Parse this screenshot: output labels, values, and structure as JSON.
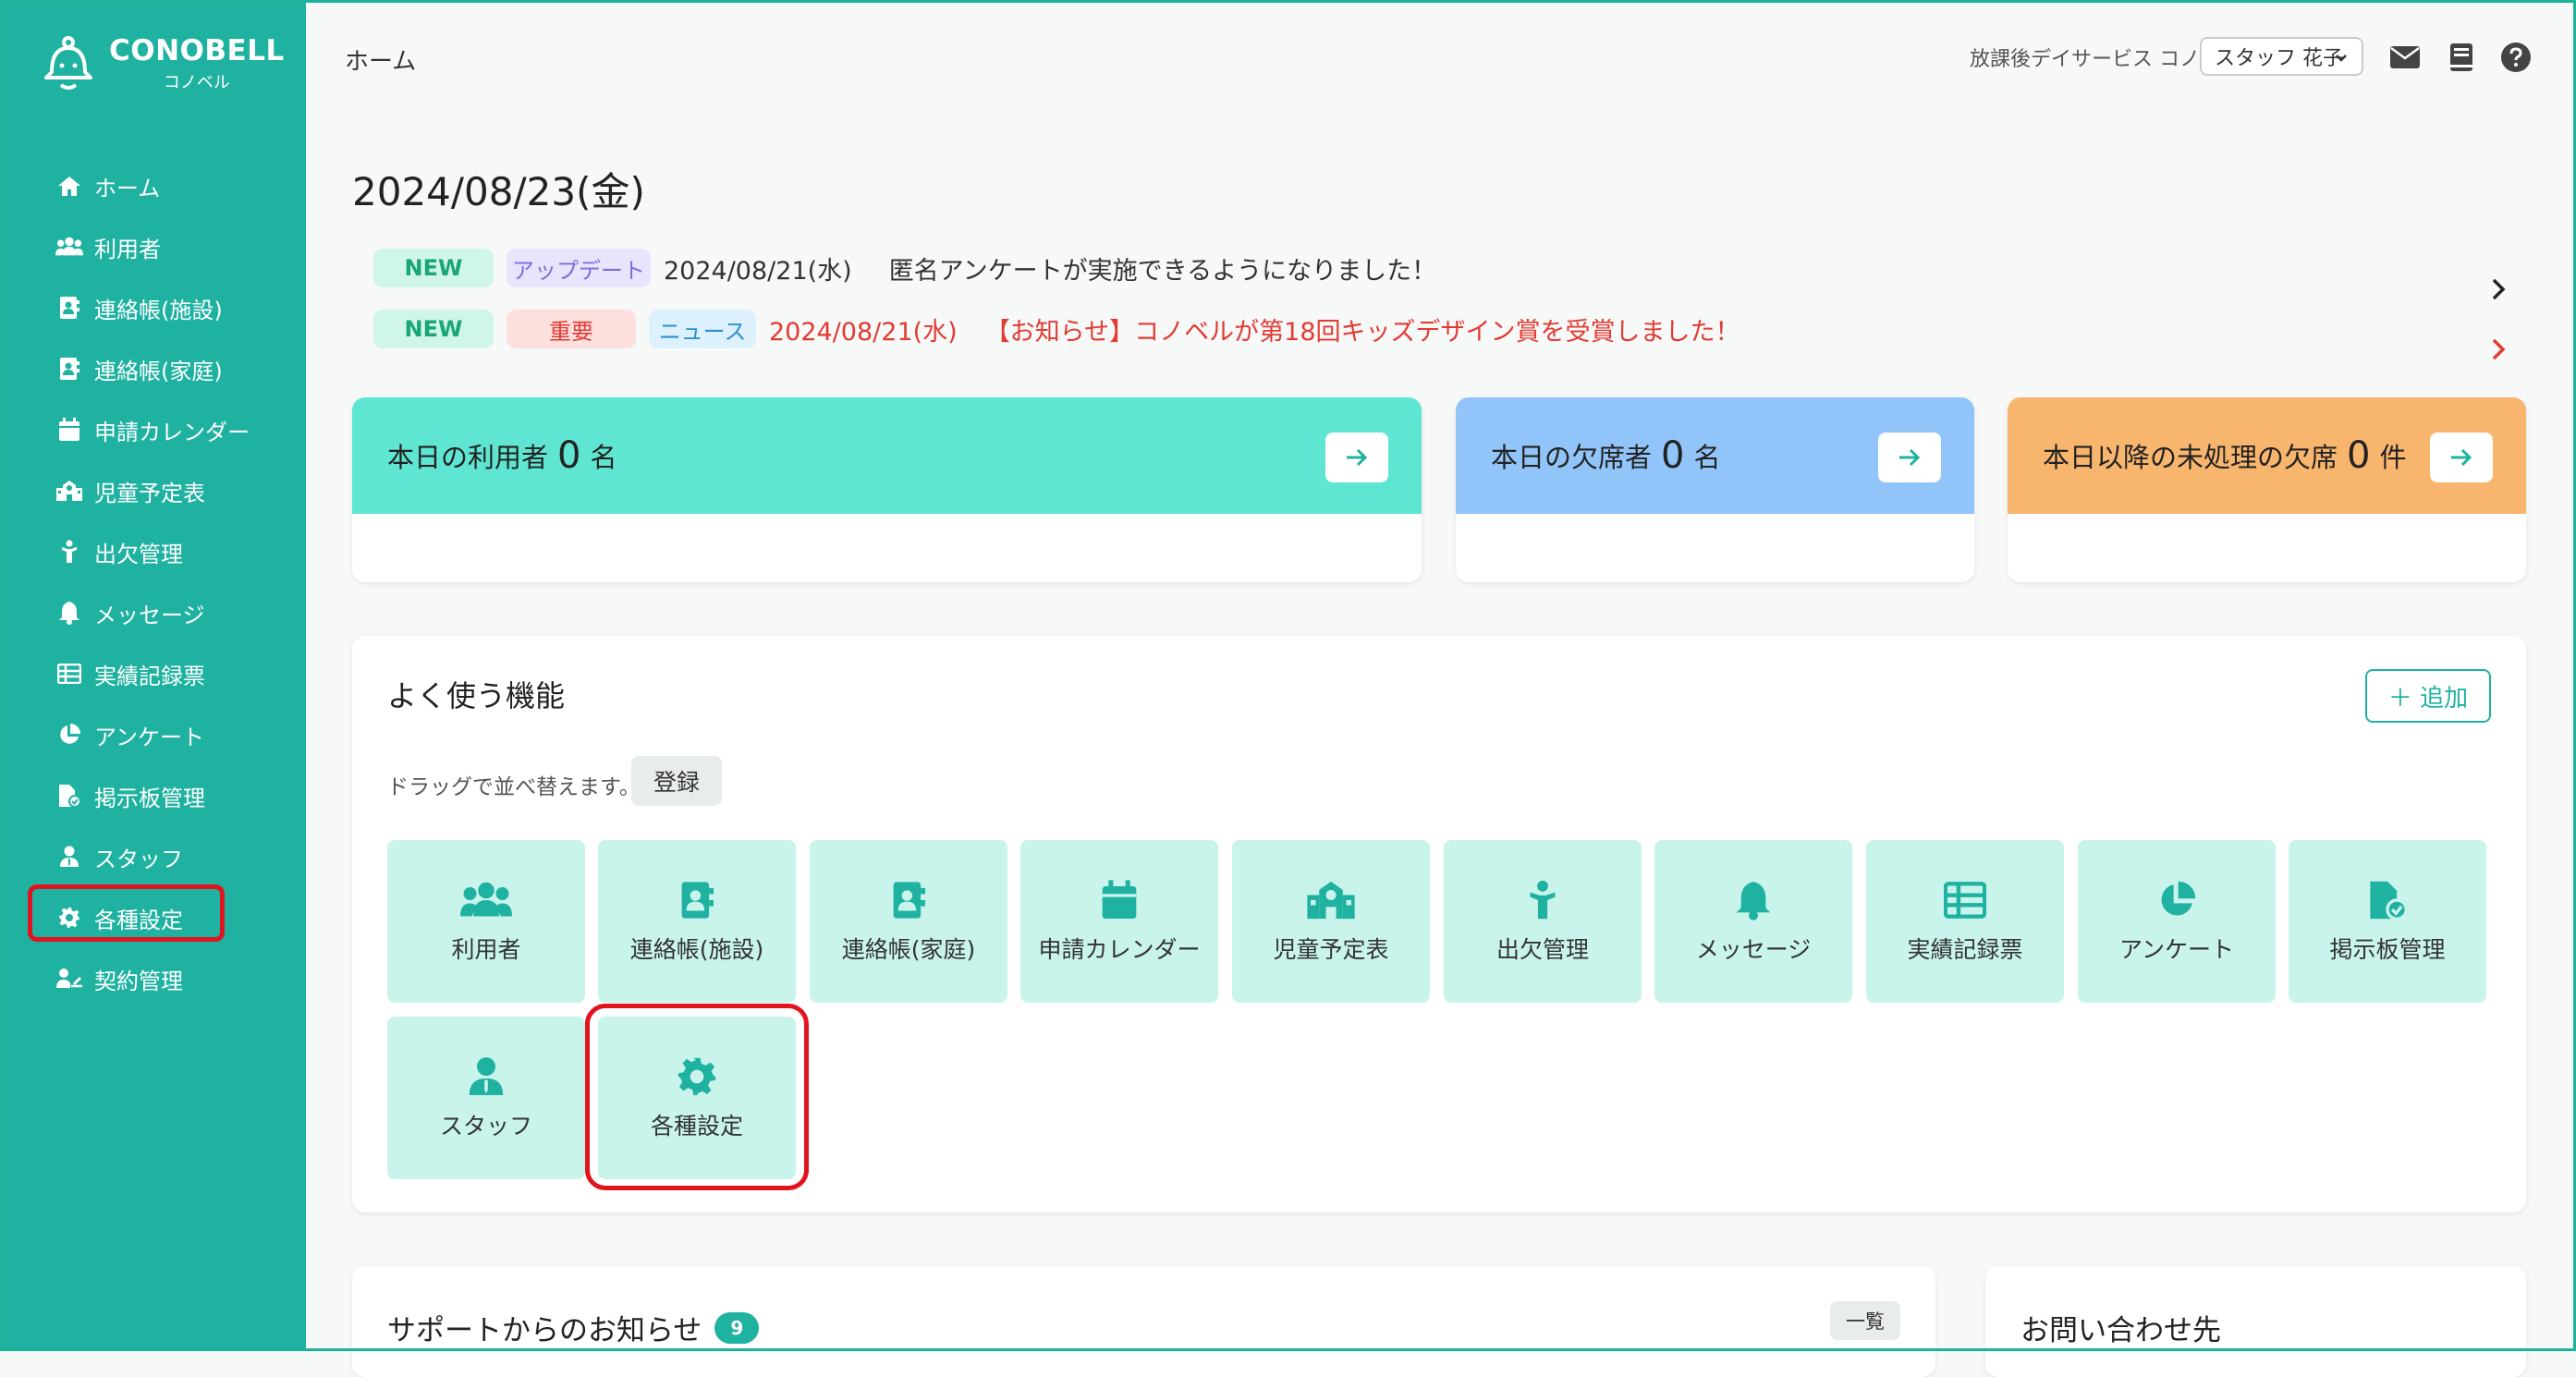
{
  "app": {
    "logo_main": "CONOBELL",
    "logo_sub": "コノベル"
  },
  "sidebar": {
    "items": [
      {
        "label": "ホーム",
        "icon": "home-icon"
      },
      {
        "label": "利用者",
        "icon": "users-icon"
      },
      {
        "label": "連絡帳(施設)",
        "icon": "contact-book-icon"
      },
      {
        "label": "連絡帳(家庭)",
        "icon": "contact-book-icon"
      },
      {
        "label": "申請カレンダー",
        "icon": "calendar-icon"
      },
      {
        "label": "児童予定表",
        "icon": "school-icon"
      },
      {
        "label": "出欠管理",
        "icon": "child-icon"
      },
      {
        "label": "メッセージ",
        "icon": "bell-icon"
      },
      {
        "label": "実績記録票",
        "icon": "table-icon"
      },
      {
        "label": "アンケート",
        "icon": "pie-icon"
      },
      {
        "label": "掲示板管理",
        "icon": "file-check-icon"
      },
      {
        "label": "スタッフ",
        "icon": "staff-icon"
      },
      {
        "label": "各種設定",
        "icon": "gear-icon"
      },
      {
        "label": "契約管理",
        "icon": "contract-icon"
      }
    ]
  },
  "header": {
    "title": "ホーム",
    "facility": "放課後デイサービス コノベル",
    "user_select": "スタッフ 花子"
  },
  "date": "2024/08/23(金)",
  "news": [
    {
      "badges": [
        "NEW",
        "アップデート"
      ],
      "date": "2024/08/21(水)",
      "text": "匿名アンケートが実施できるようになりました！"
    },
    {
      "badges": [
        "NEW",
        "重要",
        "ニュース"
      ],
      "date": "2024/08/21(水)",
      "text": "【お知らせ】コノベルが第18回キッズデザイン賞を受賞しました！"
    }
  ],
  "stats": [
    {
      "prefix": "本日の利用者",
      "value": "0",
      "unit": "名",
      "color": "#5fe6d2"
    },
    {
      "prefix": "本日の欠席者",
      "value": "0",
      "unit": "名",
      "color": "#91c4f8"
    },
    {
      "prefix": "本日以降の未処理の欠席",
      "value": "0",
      "unit": "件",
      "color": "#f8b56e"
    }
  ],
  "favorites": {
    "title": "よく使う機能",
    "add_label": "＋ 追加",
    "drag_hint": "ドラッグで並べ替えます。",
    "register_label": "登録",
    "tiles": [
      {
        "label": "利用者",
        "icon": "users-icon"
      },
      {
        "label": "連絡帳(施設)",
        "icon": "contact-book-icon"
      },
      {
        "label": "連絡帳(家庭)",
        "icon": "contact-book-icon"
      },
      {
        "label": "申請カレンダー",
        "icon": "calendar-icon"
      },
      {
        "label": "児童予定表",
        "icon": "school-icon"
      },
      {
        "label": "出欠管理",
        "icon": "child-icon"
      },
      {
        "label": "メッセージ",
        "icon": "bell-icon"
      },
      {
        "label": "実績記録票",
        "icon": "table-icon"
      },
      {
        "label": "アンケート",
        "icon": "pie-icon"
      },
      {
        "label": "掲示板管理",
        "icon": "file-check-icon"
      },
      {
        "label": "スタッフ",
        "icon": "staff-icon"
      },
      {
        "label": "各種設定",
        "icon": "gear-icon"
      }
    ]
  },
  "support": {
    "title": "サポートからのお知らせ",
    "count": "9",
    "list_label": "一覧"
  },
  "contact": {
    "title": "お問い合わせ先"
  },
  "colors": {
    "accent": "#20b2a1",
    "highlight": "#e1141e"
  }
}
